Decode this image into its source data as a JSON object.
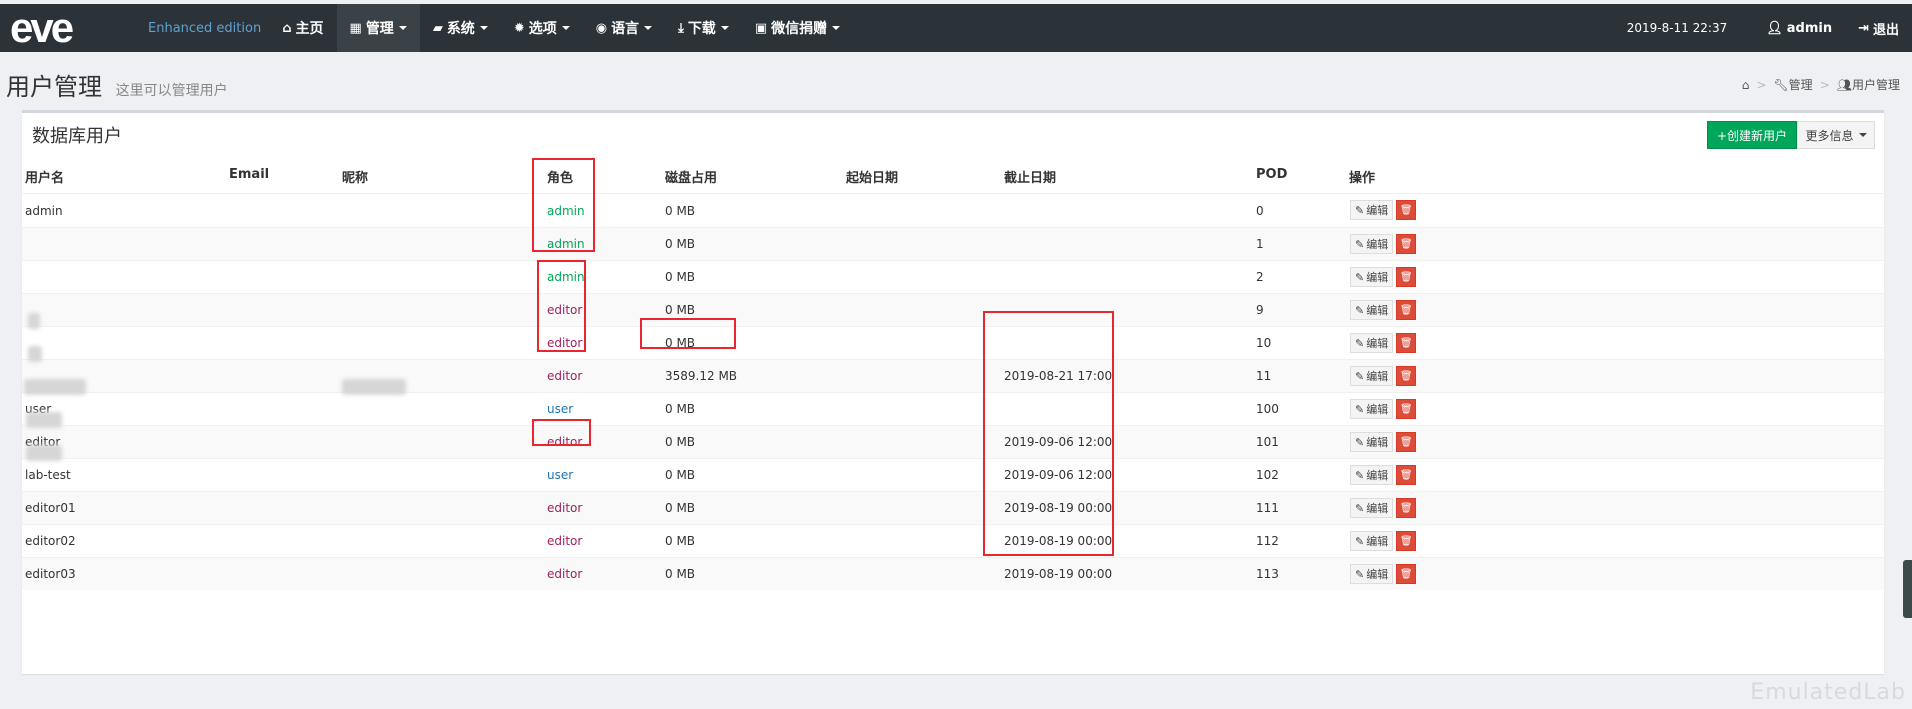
{
  "navbar": {
    "logo": "eve",
    "edition": "Enhanced edition",
    "items": [
      {
        "icon": "home-icon",
        "glyph": "⌂",
        "label": "主页",
        "dropdown": false
      },
      {
        "icon": "grid-icon",
        "glyph": "▦",
        "label": "管理",
        "dropdown": true
      },
      {
        "icon": "book-icon",
        "glyph": "▰",
        "label": "系统",
        "dropdown": true
      },
      {
        "icon": "gear-icon",
        "glyph": "✹",
        "label": "选项",
        "dropdown": true
      },
      {
        "icon": "globe-icon",
        "glyph": "◉",
        "label": "语言",
        "dropdown": true
      },
      {
        "icon": "download-icon",
        "glyph": "⤓",
        "label": "下载",
        "dropdown": true
      },
      {
        "icon": "qrcode-icon",
        "glyph": "▣",
        "label": "微信捐赠",
        "dropdown": true
      }
    ],
    "datetime": "2019-8-11  22:37",
    "user": "admin",
    "logout": "退出"
  },
  "page": {
    "title": "用户管理",
    "subtitle": "这里可以管理用户"
  },
  "breadcrumb": {
    "manage": "管理",
    "users": "用户管理"
  },
  "box": {
    "title": "数据库用户",
    "create_button": "+创建新用户",
    "more_button": "更多信息"
  },
  "table": {
    "headers": {
      "username": "用户名",
      "email": "Email",
      "nickname": "昵称",
      "role": "角色",
      "disk": "磁盘占用",
      "start": "起始日期",
      "end": "截止日期",
      "pod": "POD",
      "actions": "操作"
    },
    "edit_label": "编辑",
    "rows": [
      {
        "username": "admin",
        "role": "admin",
        "disk": "0 MB",
        "end": "",
        "pod": "0"
      },
      {
        "username": "",
        "role": "admin",
        "disk": "0 MB",
        "end": "",
        "pod": "1"
      },
      {
        "username": "",
        "role": "admin",
        "disk": "0 MB",
        "end": "",
        "pod": "2"
      },
      {
        "username": "",
        "role": "editor",
        "disk": "0 MB",
        "end": "",
        "pod": "9"
      },
      {
        "username": "",
        "role": "editor",
        "disk": "0 MB",
        "end": "",
        "pod": "10"
      },
      {
        "username": "",
        "role": "editor",
        "disk": "3589.12 MB",
        "end": "2019-08-21 17:00",
        "pod": "11"
      },
      {
        "username": "user",
        "role": "user",
        "disk": "0 MB",
        "end": "",
        "pod": "100"
      },
      {
        "username": "editor",
        "role": "editor",
        "disk": "0 MB",
        "end": "2019-09-06 12:00",
        "pod": "101"
      },
      {
        "username": "lab-test",
        "role": "user",
        "disk": "0 MB",
        "end": "2019-09-06 12:00",
        "pod": "102"
      },
      {
        "username": "editor01",
        "role": "editor",
        "disk": "0 MB",
        "end": "2019-08-19 00:00",
        "pod": "111"
      },
      {
        "username": "editor02",
        "role": "editor",
        "disk": "0 MB",
        "end": "2019-08-19 00:00",
        "pod": "112"
      },
      {
        "username": "editor03",
        "role": "editor",
        "disk": "0 MB",
        "end": "2019-08-19 00:00",
        "pod": "113"
      }
    ]
  },
  "watermark": "EmulatedLab",
  "colors": {
    "navbar": "#2b3338",
    "admin": "#00a65a",
    "editor": "#a0205f",
    "user": "#1e73b5",
    "highlight": "#e8262d"
  }
}
